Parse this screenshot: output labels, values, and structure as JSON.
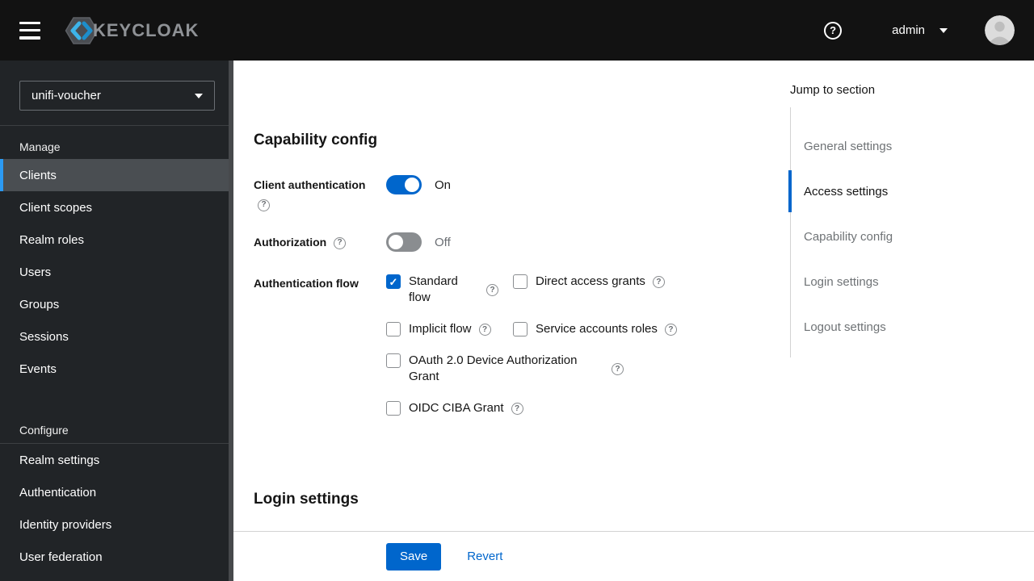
{
  "icons": {
    "question": "?",
    "check": "✓"
  },
  "colors": {
    "accent": "#0066cc",
    "nav_active_bar": "#2b9af3",
    "masthead_bg": "#121212",
    "sidebar_bg": "#212427"
  },
  "masthead": {
    "brand": "KEYCLOAK",
    "username": "admin"
  },
  "sidebar": {
    "realm": "unifi-voucher",
    "sections": [
      {
        "label": "Manage",
        "items": [
          {
            "label": "Clients",
            "active": true
          },
          {
            "label": "Client scopes"
          },
          {
            "label": "Realm roles"
          },
          {
            "label": "Users"
          },
          {
            "label": "Groups"
          },
          {
            "label": "Sessions"
          },
          {
            "label": "Events"
          }
        ]
      },
      {
        "label": "Configure",
        "items": [
          {
            "label": "Realm settings"
          },
          {
            "label": "Authentication"
          },
          {
            "label": "Identity providers"
          },
          {
            "label": "User federation"
          }
        ]
      }
    ]
  },
  "content": {
    "capability_section": {
      "title": "Capability config",
      "client_auth": {
        "label": "Client authentication",
        "state": "On",
        "enabled": true
      },
      "authorization": {
        "label": "Authorization",
        "state": "Off",
        "enabled": false
      },
      "auth_flow": {
        "label": "Authentication flow",
        "options": [
          {
            "label": "Standard flow",
            "checked": true
          },
          {
            "label": "Direct access grants",
            "checked": false
          },
          {
            "label": "Implicit flow",
            "checked": false
          },
          {
            "label": "Service accounts roles",
            "checked": false
          },
          {
            "label": "OAuth 2.0 Device Authorization Grant",
            "checked": false
          },
          {
            "label": "OIDC CIBA Grant",
            "checked": false
          }
        ]
      }
    },
    "login_section_title": "Login settings",
    "actions": {
      "save": "Save",
      "revert": "Revert"
    }
  },
  "jump_panel": {
    "title": "Jump to section",
    "items": [
      {
        "label": "General settings"
      },
      {
        "label": "Access settings",
        "active": true
      },
      {
        "label": "Capability config"
      },
      {
        "label": "Login settings"
      },
      {
        "label": "Logout settings"
      }
    ]
  }
}
